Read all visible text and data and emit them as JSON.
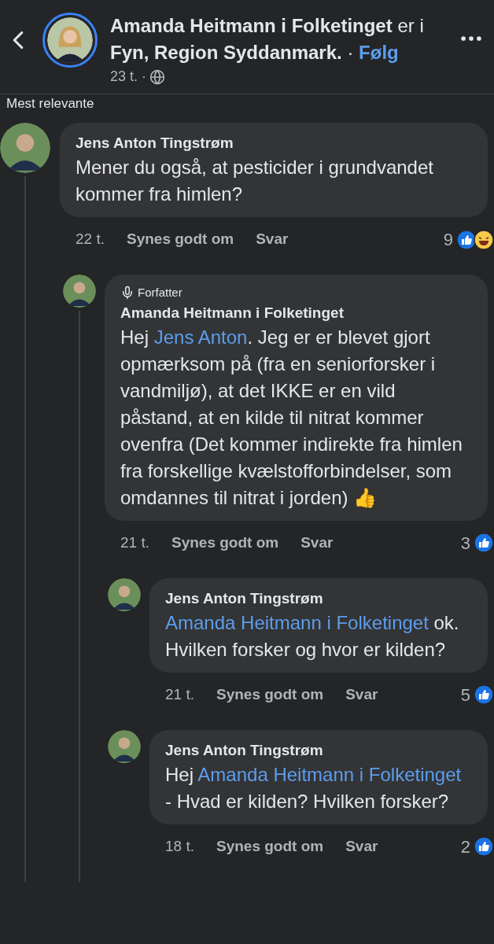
{
  "header": {
    "author": "Amanda Heitmann i Folketinget",
    "connector": "er i",
    "place": "Fyn, Region Syddanmark.",
    "separator": "·",
    "follow": "Følg",
    "time": "23 t.",
    "time_separator": "·"
  },
  "sort": "Mest relevante",
  "comments": [
    {
      "author": "Jens Anton Tingstrøm",
      "parts": [
        {
          "kind": "text",
          "text": "Mener du også, at pesticider i grundvandet kommer fra himlen?"
        }
      ],
      "time": "22 t.",
      "like": "Synes godt om",
      "reply": "Svar",
      "count": "9",
      "reactions": [
        {
          "kind": "like"
        },
        {
          "kind": "haha"
        }
      ],
      "children": [
        {
          "author": "Amanda Heitmann i Folketinget",
          "badge": "Forfatter",
          "parts": [
            {
              "kind": "text",
              "text": "Hej "
            },
            {
              "kind": "mention",
              "text": "Jens Anton"
            },
            {
              "kind": "text",
              "text": ". Jeg er er blevet gjort opmærksom på (fra en seniorforsker i vandmiljø), at det IKKE er en vild påstand, at en kilde til nitrat kommer ovenfra (Det kommer indirekte fra himlen fra forskellige kvælstofforbindelser, som omdannes til nitrat i jorden) 👍"
            }
          ],
          "time": "21 t.",
          "like": "Synes godt om",
          "reply": "Svar",
          "count": "3",
          "reactions": [
            {
              "kind": "like"
            }
          ],
          "children": [
            {
              "author": "Jens Anton Tingstrøm",
              "parts": [
                {
                  "kind": "mention",
                  "text": "Amanda Heitmann i Folketinget"
                },
                {
                  "kind": "text",
                  "text": " ok. Hvilken forsker og hvor er kilden?"
                }
              ],
              "time": "21 t.",
              "like": "Synes godt om",
              "reply": "Svar",
              "count": "5",
              "reactions": [
                {
                  "kind": "like"
                }
              ]
            },
            {
              "author": "Jens Anton Tingstrøm",
              "parts": [
                {
                  "kind": "text",
                  "text": "Hej "
                },
                {
                  "kind": "mention",
                  "text": "Amanda Heitmann i Folketinget"
                },
                {
                  "kind": "text",
                  "text": " - Hvad er kilden? Hvilken forsker?"
                }
              ],
              "time": "18 t.",
              "like": "Synes godt om",
              "reply": "Svar",
              "count": "2",
              "reactions": [
                {
                  "kind": "like"
                }
              ]
            }
          ]
        }
      ]
    }
  ]
}
